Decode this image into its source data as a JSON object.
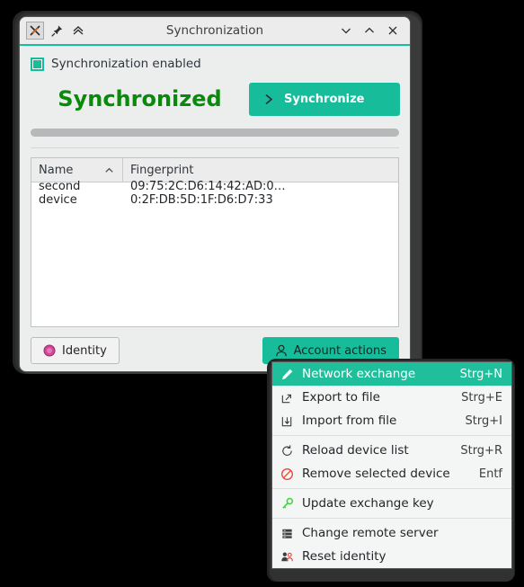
{
  "window": {
    "title": "Synchronization",
    "titlebar_buttons": {
      "app_icon": "app-icon",
      "pin": "pin-icon",
      "collapse": "double-chevron-up-icon",
      "minimize": "chevron-down-icon",
      "maximize": "chevron-up-icon",
      "close": "close-icon"
    }
  },
  "body": {
    "checkbox_label": "Synchronization enabled",
    "checkbox_checked": true,
    "status_text": "Synchronized",
    "sync_button_label": "Synchronize",
    "sync_button_icon": "chevron-right-icon",
    "progress_value": "100"
  },
  "table": {
    "columns": [
      {
        "label": "Name",
        "sort": "ascending",
        "sort_icon": "chevron-up-icon"
      },
      {
        "label": "Fingerprint",
        "sort": "none"
      }
    ],
    "rows": [
      {
        "name": "second device",
        "fingerprint": "09:75:2C:D6:14:42:AD:0…0:2F:DB:5D:1F:D6:D7:33"
      }
    ]
  },
  "footer": {
    "identity_button": {
      "label": "Identity",
      "icon": "identity-circle-icon"
    },
    "account_actions_button": {
      "label": "Account actions",
      "icon": "person-icon"
    }
  },
  "menu": {
    "items": [
      {
        "label": "Network exchange",
        "accel": "Strg+N",
        "icon": "pen-icon",
        "selected": true,
        "separator_after": false
      },
      {
        "label": "Export to file",
        "accel": "Strg+E",
        "icon": "export-icon",
        "selected": false,
        "separator_after": false
      },
      {
        "label": "Import from file",
        "accel": "Strg+I",
        "icon": "import-icon",
        "selected": false,
        "separator_after": true
      },
      {
        "label": "Reload device list",
        "accel": "Strg+R",
        "icon": "reload-icon",
        "selected": false,
        "separator_after": false
      },
      {
        "label": "Remove selected device",
        "accel": "Entf",
        "icon": "prohibited-icon",
        "selected": false,
        "separator_after": true
      },
      {
        "label": "Update exchange key",
        "accel": "",
        "icon": "key-icon",
        "selected": false,
        "separator_after": true
      },
      {
        "label": "Change remote server",
        "accel": "",
        "icon": "server-icon",
        "selected": false,
        "separator_after": false
      },
      {
        "label": "Reset identity",
        "accel": "",
        "icon": "people-icon",
        "selected": false,
        "separator_after": false
      }
    ]
  },
  "colors": {
    "accent_teal": "#17bd9b",
    "menu_highlight": "#1fbf9c",
    "status_green": "#0a8a0a",
    "identity_pink": "#d6459a",
    "key_green": "#3bd43b",
    "danger_red": "#e8453c",
    "window_bg": "#eceeee",
    "frame_dark": "#2f2f2f"
  }
}
